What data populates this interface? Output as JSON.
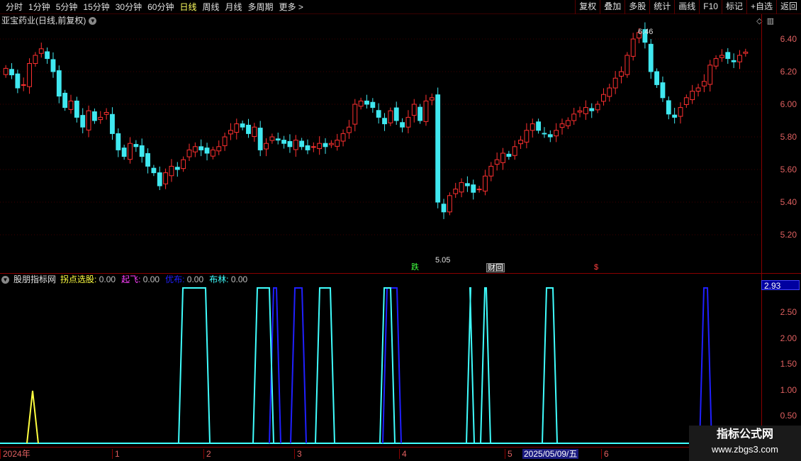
{
  "toolbar": {
    "periods": [
      "分时",
      "1分钟",
      "5分钟",
      "15分钟",
      "30分钟",
      "60分钟",
      "日线",
      "周线",
      "月线",
      "多周期",
      "更多 >"
    ],
    "active_period": "日线",
    "actions": [
      "复权",
      "叠加",
      "多股",
      "统计",
      "画线",
      "F10",
      "标记",
      "+自选",
      "返回"
    ]
  },
  "chart_title": "亚宝药业(日线,前复权)",
  "price_axis": [
    "6.40",
    "6.20",
    "6.00",
    "5.80",
    "5.60",
    "5.40",
    "5.20"
  ],
  "annotations": {
    "high": "6.46",
    "low": "5.05",
    "die": "跌",
    "caibao": "财回",
    "s_mark": "$"
  },
  "indicator": {
    "name": "股朋指标网",
    "fields": [
      {
        "label": "拐点选股:",
        "value": "0.00",
        "color": "#ffff40"
      },
      {
        "label": "起飞:",
        "value": "0.00",
        "color": "#ff40ff"
      },
      {
        "label": "优布:",
        "value": "0.00",
        "color": "#2020ff"
      },
      {
        "label": "布林:",
        "value": "0.00",
        "color": "#40ffff"
      }
    ],
    "current_value": "2.93",
    "axis": [
      "2.50",
      "2.00",
      "1.50",
      "1.00",
      "0.50"
    ]
  },
  "date_axis": {
    "labels": [
      "2024年",
      "1",
      "2",
      "3",
      "4",
      "5",
      "6"
    ],
    "highlight": "2025/05/09/五"
  },
  "watermark": {
    "main": "指标公式网",
    "sub": "www.zbgs3.com"
  },
  "chart_data": {
    "type": "candlestick",
    "title": "亚宝药业(日线,前复权)",
    "ylim": [
      5.05,
      6.46
    ],
    "close": [
      6.22,
      6.18,
      6.1,
      6.12,
      6.25,
      6.3,
      6.34,
      6.28,
      6.2,
      6.05,
      5.98,
      6.02,
      5.92,
      5.86,
      5.96,
      5.9,
      5.92,
      5.95,
      5.82,
      5.72,
      5.68,
      5.76,
      5.74,
      5.68,
      5.62,
      5.58,
      5.5,
      5.58,
      5.62,
      5.6,
      5.66,
      5.72,
      5.74,
      5.72,
      5.7,
      5.72,
      5.74,
      5.8,
      5.84,
      5.88,
      5.86,
      5.82,
      5.86,
      5.72,
      5.76,
      5.8,
      5.78,
      5.76,
      5.74,
      5.78,
      5.74,
      5.72,
      5.74,
      5.76,
      5.74,
      5.76,
      5.78,
      5.82,
      5.86,
      6.0,
      6.02,
      6.0,
      5.98,
      5.92,
      5.88,
      5.96,
      5.9,
      5.86,
      5.92,
      6.0,
      5.9,
      6.02,
      6.04,
      5.4,
      5.34,
      5.44,
      5.48,
      5.52,
      5.5,
      5.46,
      5.48,
      5.56,
      5.62,
      5.66,
      5.7,
      5.68,
      5.74,
      5.78,
      5.84,
      5.88,
      5.84,
      5.82,
      5.8,
      5.84,
      5.88,
      5.9,
      5.94,
      5.96,
      5.98,
      5.96,
      6.0,
      6.06,
      6.1,
      6.16,
      6.2,
      6.3,
      6.4,
      6.44,
      6.38,
      6.2,
      6.12,
      6.04,
      5.94,
      5.92,
      5.98,
      6.04,
      6.08,
      6.1,
      6.14,
      6.24,
      6.28,
      6.3,
      6.28,
      6.26,
      6.3,
      6.32
    ]
  }
}
